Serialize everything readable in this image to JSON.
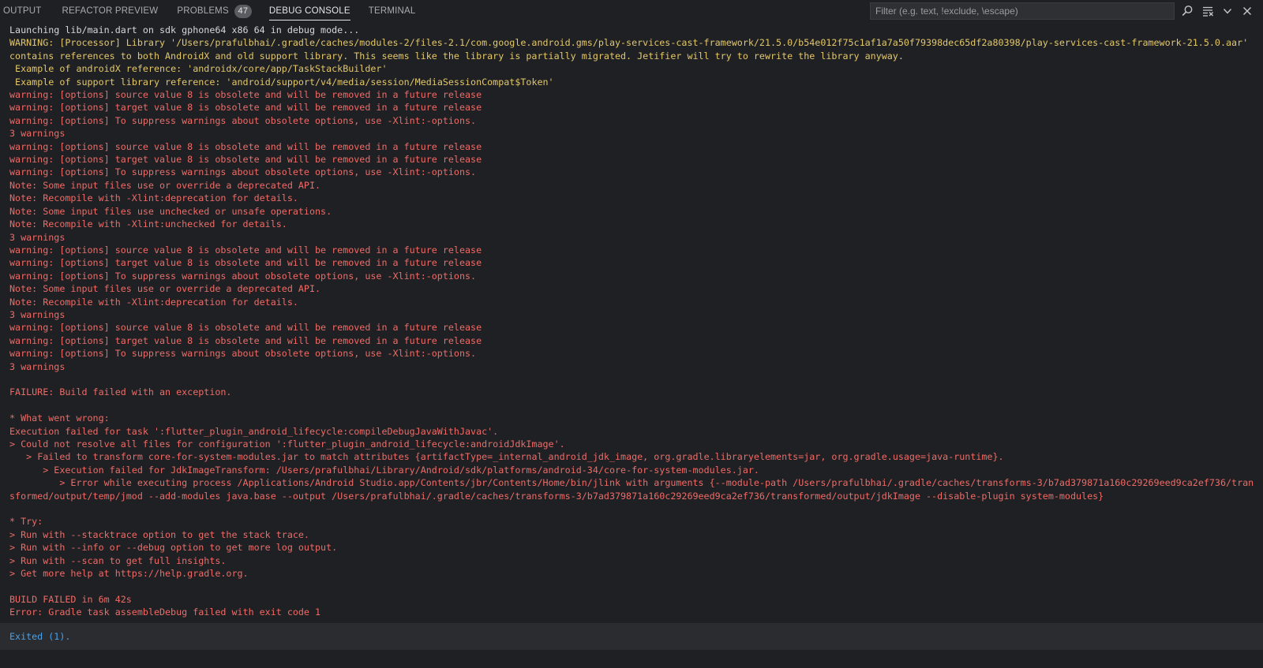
{
  "tabs": [
    {
      "label": "OUTPUT",
      "active": false
    },
    {
      "label": "REFACTOR PREVIEW",
      "active": false
    },
    {
      "label": "PROBLEMS",
      "active": false,
      "badge": "47"
    },
    {
      "label": "DEBUG CONSOLE",
      "active": true
    },
    {
      "label": "TERMINAL",
      "active": false
    }
  ],
  "filter": {
    "placeholder": "Filter (e.g. text, !exclude, \\escape)",
    "value": ""
  },
  "header_icons": [
    "search-icon",
    "clear-console-icon",
    "chevron-down-icon",
    "close-icon"
  ],
  "colors": {
    "background": "#1f2023",
    "plain": "#d6d7d9",
    "warning": "#e3c76a",
    "error": "#ee6b67",
    "info": "#4aa0e6"
  },
  "console": {
    "lines": [
      {
        "text": "Launching lib/main.dart on sdk gphone64 x86 64 in debug mode...",
        "kind": "plain"
      },
      {
        "text": "WARNING: [Processor] Library '/Users/prafulbhai/.gradle/caches/modules-2/files-2.1/com.google.android.gms/play-services-cast-framework/21.5.0/b54e012f75c1af1a7a50f79398dec65df2a80398/play-services-cast-framework-21.5.0.aar' contains references to both AndroidX and old support library. This seems like the library is partially migrated. Jetifier will try to rewrite the library anyway.",
        "kind": "warn"
      },
      {
        "text": " Example of androidX reference: 'androidx/core/app/TaskStackBuilder'",
        "kind": "warn"
      },
      {
        "text": " Example of support library reference: 'android/support/v4/media/session/MediaSessionCompat$Token'",
        "kind": "warn"
      },
      {
        "text": "warning: [options] source value 8 is obsolete and will be removed in a future release",
        "kind": "err"
      },
      {
        "text": "warning: [options] target value 8 is obsolete and will be removed in a future release",
        "kind": "err"
      },
      {
        "text": "warning: [options] To suppress warnings about obsolete options, use -Xlint:-options.",
        "kind": "err"
      },
      {
        "text": "3 warnings",
        "kind": "err"
      },
      {
        "text": "warning: [options] source value 8 is obsolete and will be removed in a future release",
        "kind": "err"
      },
      {
        "text": "warning: [options] target value 8 is obsolete and will be removed in a future release",
        "kind": "err"
      },
      {
        "text": "warning: [options] To suppress warnings about obsolete options, use -Xlint:-options.",
        "kind": "err"
      },
      {
        "text": "Note: Some input files use or override a deprecated API.",
        "kind": "err"
      },
      {
        "text": "Note: Recompile with -Xlint:deprecation for details.",
        "kind": "err"
      },
      {
        "text": "Note: Some input files use unchecked or unsafe operations.",
        "kind": "err"
      },
      {
        "text": "Note: Recompile with -Xlint:unchecked for details.",
        "kind": "err"
      },
      {
        "text": "3 warnings",
        "kind": "err"
      },
      {
        "text": "warning: [options] source value 8 is obsolete and will be removed in a future release",
        "kind": "err"
      },
      {
        "text": "warning: [options] target value 8 is obsolete and will be removed in a future release",
        "kind": "err"
      },
      {
        "text": "warning: [options] To suppress warnings about obsolete options, use -Xlint:-options.",
        "kind": "err"
      },
      {
        "text": "Note: Some input files use or override a deprecated API.",
        "kind": "err"
      },
      {
        "text": "Note: Recompile with -Xlint:deprecation for details.",
        "kind": "err"
      },
      {
        "text": "3 warnings",
        "kind": "err"
      },
      {
        "text": "warning: [options] source value 8 is obsolete and will be removed in a future release",
        "kind": "err"
      },
      {
        "text": "warning: [options] target value 8 is obsolete and will be removed in a future release",
        "kind": "err"
      },
      {
        "text": "warning: [options] To suppress warnings about obsolete options, use -Xlint:-options.",
        "kind": "err"
      },
      {
        "text": "3 warnings",
        "kind": "err"
      },
      {
        "text": "",
        "kind": "err"
      },
      {
        "text": "FAILURE: Build failed with an exception.",
        "kind": "err"
      },
      {
        "text": "",
        "kind": "err"
      },
      {
        "text": "* What went wrong:",
        "kind": "err"
      },
      {
        "text": "Execution failed for task ':flutter_plugin_android_lifecycle:compileDebugJavaWithJavac'.",
        "kind": "err"
      },
      {
        "text": "> Could not resolve all files for configuration ':flutter_plugin_android_lifecycle:androidJdkImage'.",
        "kind": "err"
      },
      {
        "text": "   > Failed to transform core-for-system-modules.jar to match attributes {artifactType=_internal_android_jdk_image, org.gradle.libraryelements=jar, org.gradle.usage=java-runtime}.",
        "kind": "err"
      },
      {
        "text": "      > Execution failed for JdkImageTransform: /Users/prafulbhai/Library/Android/sdk/platforms/android-34/core-for-system-modules.jar.",
        "kind": "err"
      },
      {
        "text": "         > Error while executing process /Applications/Android Studio.app/Contents/jbr/Contents/Home/bin/jlink with arguments {--module-path /Users/prafulbhai/.gradle/caches/transforms-3/b7ad379871a160c29269eed9ca2ef736/transformed/output/temp/jmod --add-modules java.base --output /Users/prafulbhai/.gradle/caches/transforms-3/b7ad379871a160c29269eed9ca2ef736/transformed/output/jdkImage --disable-plugin system-modules}",
        "kind": "err"
      },
      {
        "text": "",
        "kind": "err"
      },
      {
        "text": "* Try:",
        "kind": "err"
      },
      {
        "text": "> Run with --stacktrace option to get the stack trace.",
        "kind": "err"
      },
      {
        "text": "> Run with --info or --debug option to get more log output.",
        "kind": "err"
      },
      {
        "text": "> Run with --scan to get full insights.",
        "kind": "err"
      },
      {
        "text": "> Get more help at https://help.gradle.org.",
        "kind": "err"
      },
      {
        "text": "",
        "kind": "err"
      },
      {
        "text": "BUILD FAILED in 6m 42s",
        "kind": "err"
      },
      {
        "text": "Error: Gradle task assembleDebug failed with exit code 1",
        "kind": "err"
      }
    ],
    "exit_text": "Exited (1)."
  }
}
